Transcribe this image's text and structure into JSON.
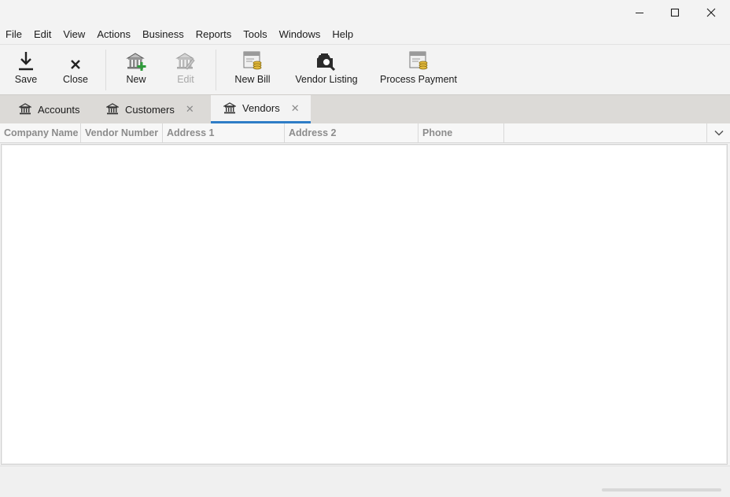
{
  "window": {
    "controls": {
      "minimize": "minimize-icon",
      "maximize": "maximize-icon",
      "close": "close-icon"
    }
  },
  "menu": [
    "File",
    "Edit",
    "View",
    "Actions",
    "Business",
    "Reports",
    "Tools",
    "Windows",
    "Help"
  ],
  "toolbar": {
    "save": {
      "label": "Save",
      "icon": "download-icon"
    },
    "close": {
      "label": "Close",
      "icon": "x-icon"
    },
    "new": {
      "label": "New",
      "icon": "bank-add-icon"
    },
    "edit": {
      "label": "Edit",
      "icon": "bank-edit-icon",
      "enabled": false
    },
    "new_bill": {
      "label": "New Bill",
      "icon": "bill-icon"
    },
    "vendor_listing": {
      "label": "Vendor Listing",
      "icon": "vendor-search-icon"
    },
    "process_payment": {
      "label": "Process Payment",
      "icon": "payment-icon"
    }
  },
  "tabs": [
    {
      "label": "Accounts",
      "closable": false,
      "active": false
    },
    {
      "label": "Customers",
      "closable": true,
      "active": false
    },
    {
      "label": "Vendors",
      "closable": true,
      "active": true
    }
  ],
  "tab_close_glyph": "✕",
  "grid": {
    "columns": [
      "Company Name",
      "Vendor Number",
      "Address 1",
      "Address 2",
      "Phone"
    ],
    "sort_column": "Company Name",
    "sort_glyph": "↗",
    "rows": []
  },
  "colors": {
    "accent": "#2e7dc6",
    "tab_bar": "#dcdad7",
    "coin": "#e2b93b",
    "plus": "#2e9b3a"
  }
}
